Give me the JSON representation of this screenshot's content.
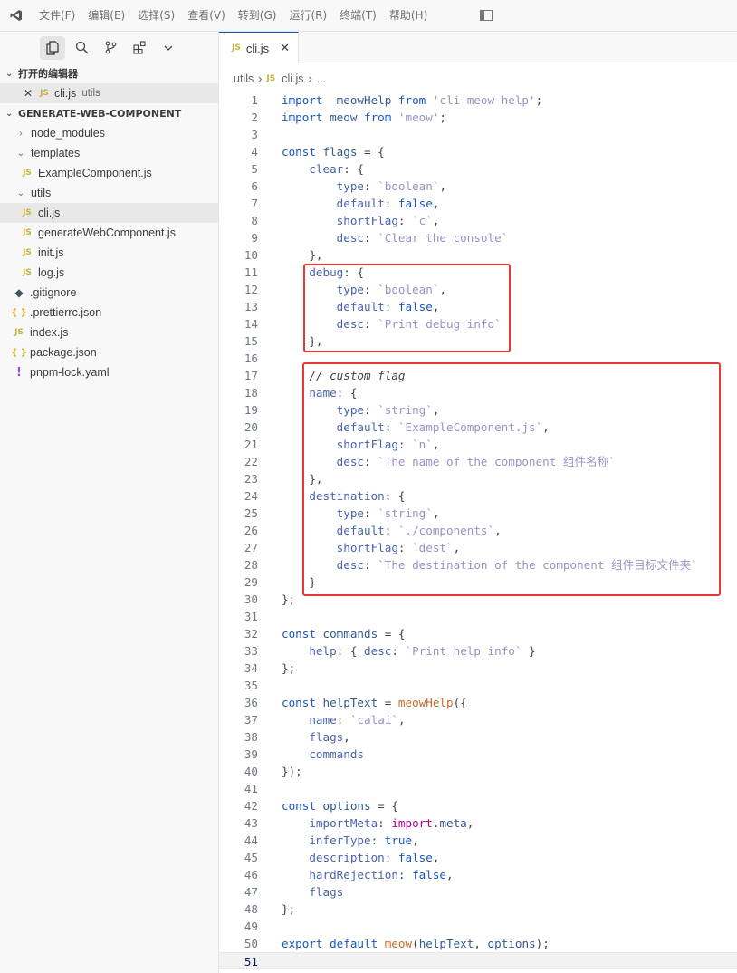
{
  "menu": {
    "items": [
      "文件(F)",
      "编辑(E)",
      "选择(S)",
      "查看(V)",
      "转到(G)",
      "运行(R)",
      "终端(T)",
      "帮助(H)"
    ]
  },
  "sidebar": {
    "open_editors_title": "打开的编辑器",
    "open_editor": {
      "name": "cli.js",
      "folder": "utils",
      "icon": "JS"
    },
    "project_title": "GENERATE-WEB-COMPONENT",
    "tree": [
      {
        "label": "node_modules",
        "type": "folder",
        "indent": 0,
        "state": "collapsed"
      },
      {
        "label": "templates",
        "type": "folder",
        "indent": 0,
        "state": "expanded"
      },
      {
        "label": "ExampleComponent.js",
        "type": "js",
        "indent": 1
      },
      {
        "label": "utils",
        "type": "folder",
        "indent": 0,
        "state": "expanded"
      },
      {
        "label": "cli.js",
        "type": "js",
        "indent": 1,
        "selected": true
      },
      {
        "label": "generateWebComponent.js",
        "type": "js",
        "indent": 1
      },
      {
        "label": "init.js",
        "type": "js",
        "indent": 1
      },
      {
        "label": "log.js",
        "type": "js",
        "indent": 1
      },
      {
        "label": ".gitignore",
        "type": "git",
        "indent": 0
      },
      {
        "label": ".prettierrc.json",
        "type": "json",
        "indent": 0
      },
      {
        "label": "index.js",
        "type": "js",
        "indent": 0
      },
      {
        "label": "package.json",
        "type": "json",
        "indent": 0
      },
      {
        "label": "pnpm-lock.yaml",
        "type": "yaml",
        "indent": 0
      }
    ]
  },
  "editor": {
    "tab_label": "cli.js",
    "tab_icon": "JS",
    "breadcrumb": {
      "folder": "utils",
      "file": "cli.js",
      "more": "..."
    },
    "current_line": 51
  },
  "icons": {
    "js": "JS",
    "json": "{ }",
    "git": "◆",
    "yaml": "!",
    "close": "✕",
    "chevron_right": "›",
    "chevron_down": "⌄",
    "breadcrumb_sep": "›"
  },
  "code": [
    [
      [
        "kw",
        "import"
      ],
      [
        "",
        "  "
      ],
      [
        "id",
        "meowHelp"
      ],
      [
        "",
        ""
      ],
      [
        "kw",
        " from "
      ],
      [
        "str",
        "'cli-meow-help'"
      ],
      [
        "punc",
        ";"
      ]
    ],
    [
      [
        "kw",
        "import"
      ],
      [
        "",
        ""
      ],
      [
        "id",
        " meow"
      ],
      [
        "kw",
        " from "
      ],
      [
        "str",
        "'meow'"
      ],
      [
        "punc",
        ";"
      ]
    ],
    [],
    [
      [
        "kw",
        "const"
      ],
      [
        "id",
        " flags"
      ],
      [
        "punc",
        " = {"
      ]
    ],
    [
      [
        "",
        "    "
      ],
      [
        "prop",
        "clear"
      ],
      [
        "punc",
        ": {"
      ]
    ],
    [
      [
        "",
        "        "
      ],
      [
        "prop",
        "type"
      ],
      [
        "punc",
        ": "
      ],
      [
        "str",
        "`boolean`"
      ],
      [
        "punc",
        ","
      ]
    ],
    [
      [
        "",
        "        "
      ],
      [
        "prop",
        "default"
      ],
      [
        "punc",
        ": "
      ],
      [
        "kw",
        "false"
      ],
      [
        "punc",
        ","
      ]
    ],
    [
      [
        "",
        "        "
      ],
      [
        "prop",
        "shortFlag"
      ],
      [
        "punc",
        ": "
      ],
      [
        "str",
        "`c`"
      ],
      [
        "punc",
        ","
      ]
    ],
    [
      [
        "",
        "        "
      ],
      [
        "prop",
        "desc"
      ],
      [
        "punc",
        ": "
      ],
      [
        "str",
        "`Clear the console`"
      ]
    ],
    [
      [
        "",
        "    "
      ],
      [
        "punc",
        "},"
      ]
    ],
    [
      [
        "",
        "    "
      ],
      [
        "prop",
        "debug"
      ],
      [
        "punc",
        ": {"
      ]
    ],
    [
      [
        "",
        "        "
      ],
      [
        "prop",
        "type"
      ],
      [
        "punc",
        ": "
      ],
      [
        "str",
        "`boolean`"
      ],
      [
        "punc",
        ","
      ]
    ],
    [
      [
        "",
        "        "
      ],
      [
        "prop",
        "default"
      ],
      [
        "punc",
        ": "
      ],
      [
        "kw",
        "false"
      ],
      [
        "punc",
        ","
      ]
    ],
    [
      [
        "",
        "        "
      ],
      [
        "prop",
        "desc"
      ],
      [
        "punc",
        ": "
      ],
      [
        "str",
        "`Print debug info`"
      ]
    ],
    [
      [
        "",
        "    "
      ],
      [
        "punc",
        "},"
      ]
    ],
    [],
    [
      [
        "",
        "    "
      ],
      [
        "cmt",
        "// custom flag"
      ]
    ],
    [
      [
        "",
        "    "
      ],
      [
        "prop",
        "name"
      ],
      [
        "punc",
        ": {"
      ]
    ],
    [
      [
        "",
        "        "
      ],
      [
        "prop",
        "type"
      ],
      [
        "punc",
        ": "
      ],
      [
        "str",
        "`string`"
      ],
      [
        "punc",
        ","
      ]
    ],
    [
      [
        "",
        "        "
      ],
      [
        "prop",
        "default"
      ],
      [
        "punc",
        ": "
      ],
      [
        "str",
        "`ExampleComponent.js`"
      ],
      [
        "punc",
        ","
      ]
    ],
    [
      [
        "",
        "        "
      ],
      [
        "prop",
        "shortFlag"
      ],
      [
        "punc",
        ": "
      ],
      [
        "str",
        "`n`"
      ],
      [
        "punc",
        ","
      ]
    ],
    [
      [
        "",
        "        "
      ],
      [
        "prop",
        "desc"
      ],
      [
        "punc",
        ": "
      ],
      [
        "str",
        "`The name of the component 组件名称`"
      ]
    ],
    [
      [
        "",
        "    "
      ],
      [
        "punc",
        "},"
      ]
    ],
    [
      [
        "",
        "    "
      ],
      [
        "prop",
        "destination"
      ],
      [
        "punc",
        ": {"
      ]
    ],
    [
      [
        "",
        "        "
      ],
      [
        "prop",
        "type"
      ],
      [
        "punc",
        ": "
      ],
      [
        "str",
        "`string`"
      ],
      [
        "punc",
        ","
      ]
    ],
    [
      [
        "",
        "        "
      ],
      [
        "prop",
        "default"
      ],
      [
        "punc",
        ": "
      ],
      [
        "str",
        "`./components`"
      ],
      [
        "punc",
        ","
      ]
    ],
    [
      [
        "",
        "        "
      ],
      [
        "prop",
        "shortFlag"
      ],
      [
        "punc",
        ": "
      ],
      [
        "str",
        "`dest`"
      ],
      [
        "punc",
        ","
      ]
    ],
    [
      [
        "",
        "        "
      ],
      [
        "prop",
        "desc"
      ],
      [
        "punc",
        ": "
      ],
      [
        "str",
        "`The destination of the component 组件目标文件夹`"
      ]
    ],
    [
      [
        "",
        "    "
      ],
      [
        "punc",
        "}"
      ]
    ],
    [
      [
        "punc",
        "};"
      ]
    ],
    [],
    [
      [
        "kw",
        "const"
      ],
      [
        "id",
        " commands"
      ],
      [
        "punc",
        " = {"
      ]
    ],
    [
      [
        "",
        "    "
      ],
      [
        "prop",
        "help"
      ],
      [
        "punc",
        ": { "
      ],
      [
        "prop",
        "desc"
      ],
      [
        "punc",
        ": "
      ],
      [
        "str",
        "`Print help info`"
      ],
      [
        "punc",
        " }"
      ]
    ],
    [
      [
        "punc",
        "};"
      ]
    ],
    [],
    [
      [
        "kw",
        "const"
      ],
      [
        "id",
        " helpText"
      ],
      [
        "punc",
        " = "
      ],
      [
        "fn",
        "meowHelp"
      ],
      [
        "punc",
        "({"
      ]
    ],
    [
      [
        "",
        "    "
      ],
      [
        "prop",
        "name"
      ],
      [
        "punc",
        ": "
      ],
      [
        "str",
        "`calai`"
      ],
      [
        "punc",
        ","
      ]
    ],
    [
      [
        "",
        "    "
      ],
      [
        "prop",
        "flags"
      ],
      [
        "punc",
        ","
      ]
    ],
    [
      [
        "",
        "    "
      ],
      [
        "prop",
        "commands"
      ]
    ],
    [
      [
        "punc",
        "});"
      ]
    ],
    [],
    [
      [
        "kw",
        "const"
      ],
      [
        "id",
        " options"
      ],
      [
        "punc",
        " = {"
      ]
    ],
    [
      [
        "",
        "    "
      ],
      [
        "prop",
        "importMeta"
      ],
      [
        "punc",
        ": "
      ],
      [
        "kwi",
        "import"
      ],
      [
        "punc",
        "."
      ],
      [
        "id",
        "meta"
      ],
      [
        "punc",
        ","
      ]
    ],
    [
      [
        "",
        "    "
      ],
      [
        "prop",
        "inferType"
      ],
      [
        "punc",
        ": "
      ],
      [
        "kw",
        "true"
      ],
      [
        "punc",
        ","
      ]
    ],
    [
      [
        "",
        "    "
      ],
      [
        "prop",
        "description"
      ],
      [
        "punc",
        ": "
      ],
      [
        "kw",
        "false"
      ],
      [
        "punc",
        ","
      ]
    ],
    [
      [
        "",
        "    "
      ],
      [
        "prop",
        "hardRejection"
      ],
      [
        "punc",
        ": "
      ],
      [
        "kw",
        "false"
      ],
      [
        "punc",
        ","
      ]
    ],
    [
      [
        "",
        "    "
      ],
      [
        "prop",
        "flags"
      ]
    ],
    [
      [
        "punc",
        "};"
      ]
    ],
    [],
    [
      [
        "kw",
        "export"
      ],
      [
        "kw",
        " default "
      ],
      [
        "fn",
        "meow"
      ],
      [
        "punc",
        "("
      ],
      [
        "id",
        "helpText"
      ],
      [
        "punc",
        ", "
      ],
      [
        "id",
        "options"
      ],
      [
        "punc",
        ");"
      ]
    ],
    []
  ]
}
